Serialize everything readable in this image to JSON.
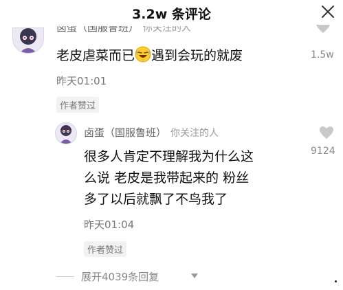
{
  "header": {
    "title": "3.2w 条评论"
  },
  "comments": [
    {
      "author": "卤蛋（国服鲁班）",
      "tag": "你关注的人",
      "text_before_emoji": "老皮虐菜而已",
      "emoji": "rofl-emoji",
      "text_after_emoji": "遇到会玩的就废",
      "time": "昨天01:01",
      "badge": "作者赞过",
      "like_count": "1.5w"
    },
    {
      "author": "卤蛋（国服鲁班）",
      "tag": "你关注的人",
      "lines": [
        "很多人肯定不理解我为什么这",
        "么说 老皮是我带起来的 粉丝",
        "多了以后就飘了不鸟我了"
      ],
      "time": "昨天01:04",
      "badge": "作者赞过",
      "like_count": "9124"
    }
  ],
  "expand": {
    "label": "展开4039条回复"
  },
  "colors": {
    "text": "#111111",
    "secondary": "#777777",
    "badge_bg": "#f2f2f2"
  },
  "icons": {
    "close": "close-icon",
    "like": "heart-outline-icon",
    "expand": "triangle-down-icon"
  }
}
